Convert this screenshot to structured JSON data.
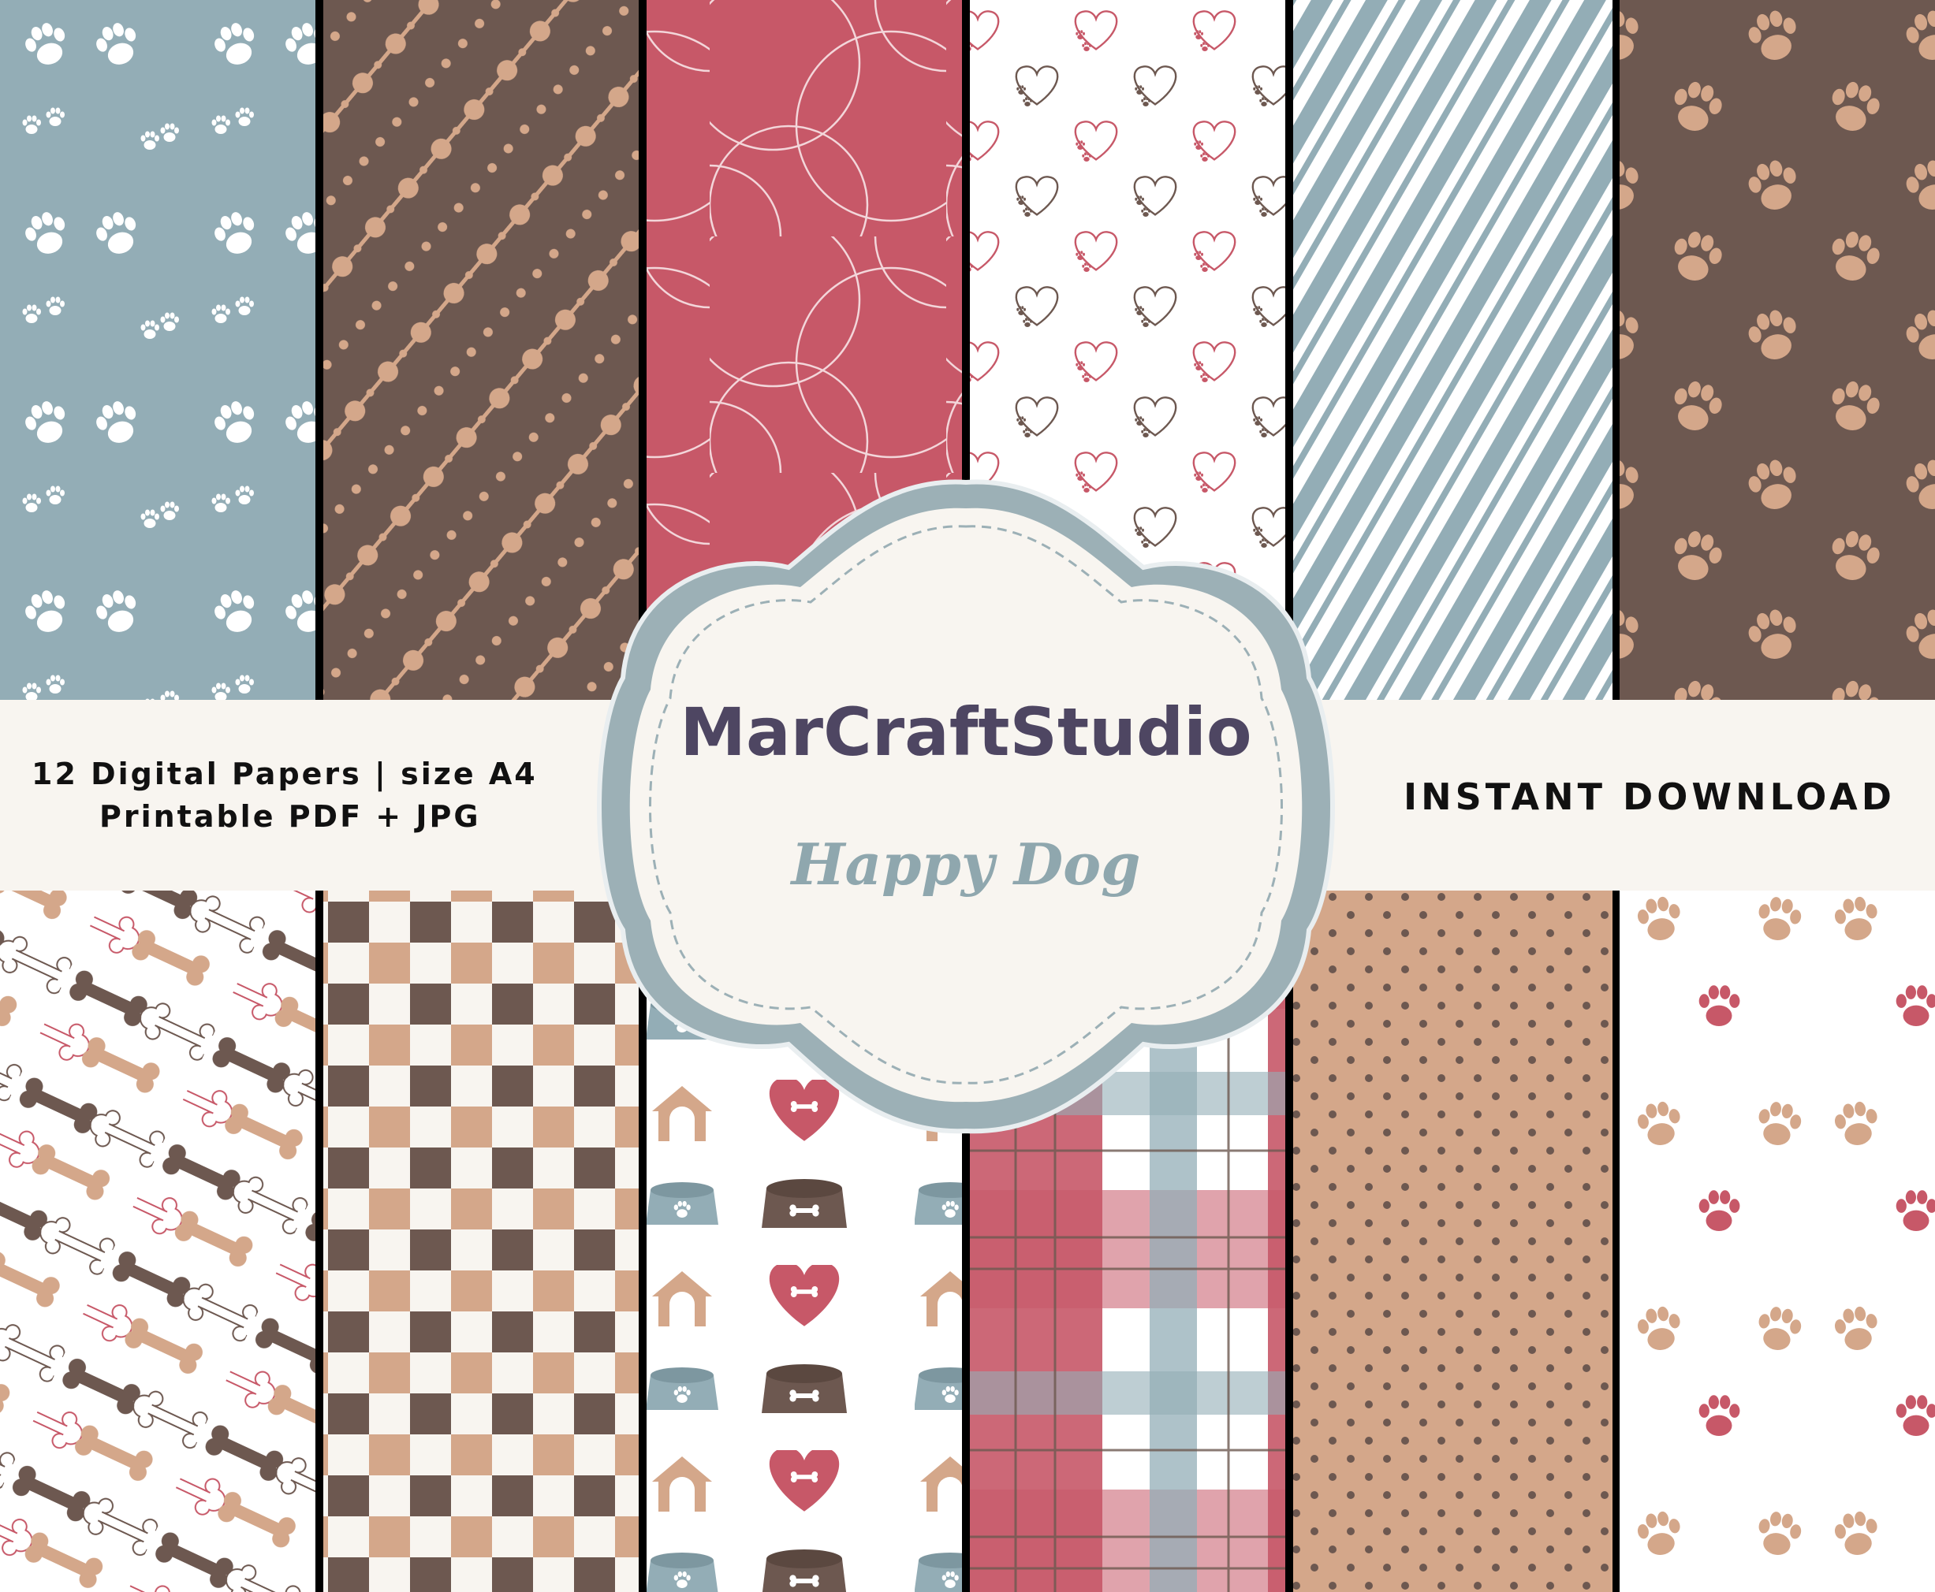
{
  "banner": {
    "left_line_1": "12 Digital Papers | size A4",
    "left_line_2": "Printable PDF + JPG",
    "right_text": "INSTANT DOWNLOAD"
  },
  "badge": {
    "brand": "MarCraftStudio",
    "subtitle": "Happy Dog"
  },
  "colors": {
    "blue": "#93adb6",
    "brown": "#6d5850",
    "tan": "#d4a78a",
    "red": "#c75868",
    "cream": "#f8f5f0",
    "white": "#ffffff",
    "badge_border": "#9cb0b6",
    "brand_text": "#4e4662"
  },
  "papers": [
    {
      "pattern": "paw-trail-on-blue"
    },
    {
      "pattern": "diagonal-bead-strings-on-brown"
    },
    {
      "pattern": "overlapping-circles-on-red"
    },
    {
      "pattern": "paw-hearts-on-white"
    },
    {
      "pattern": "diagonal-blue-stripes"
    },
    {
      "pattern": "tan-paws-on-brown"
    },
    {
      "pattern": "multicolor-bones-on-white"
    },
    {
      "pattern": "brown-tan-checkerboard"
    },
    {
      "pattern": "doghouse-heart-bowl-icons"
    },
    {
      "pattern": "red-blue-plaid"
    },
    {
      "pattern": "brown-dots-on-tan"
    },
    {
      "pattern": "tan-red-paws-on-white"
    }
  ]
}
